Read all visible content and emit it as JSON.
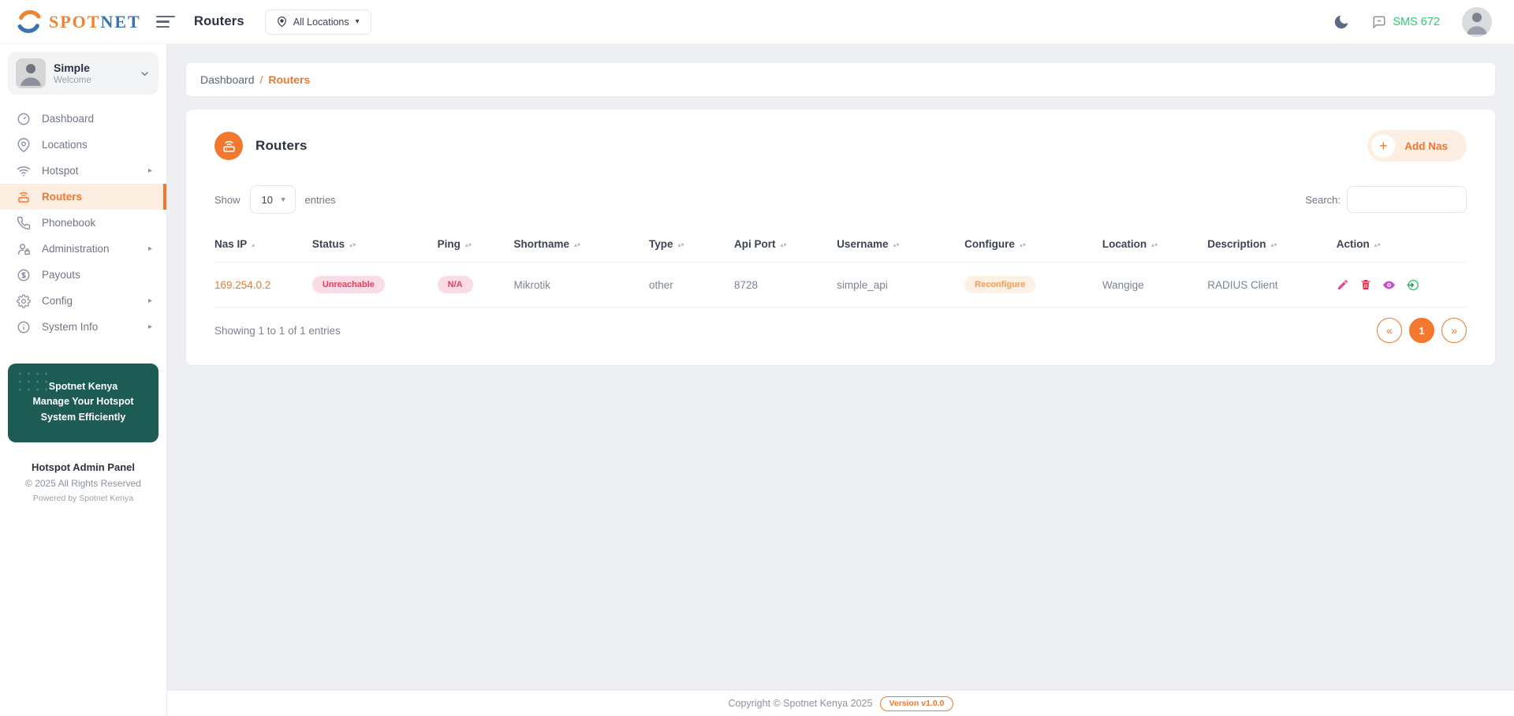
{
  "colors": {
    "accent": "#f4772e",
    "accent_soft": "#fdeee2",
    "danger_text": "#f23a5e",
    "danger_bg": "#fbdce4",
    "reconfigure_text": "#f59d54",
    "reconfigure_bg": "#fdf0e4",
    "sms_green": "#2ecc71",
    "promo_teal": "#1d5c55",
    "logo_orange": "#ee8432",
    "logo_blue": "#3a72b5"
  },
  "topbar": {
    "logo_part1": "SPOT",
    "logo_part2": "NET",
    "page_title": "Routers",
    "location_button": "All Locations",
    "location_caret": "▾",
    "sms_badge": "SMS 672",
    "icons": {
      "menu": "hamburger-icon",
      "dark_mode": "moon-icon",
      "messages": "chat-icon",
      "profile": "avatar"
    }
  },
  "sidebar": {
    "user": {
      "name": "Simple",
      "subtitle": "Welcome"
    },
    "items": [
      {
        "label": "Dashboard",
        "icon": "gauge-icon",
        "expandable": false,
        "active": false
      },
      {
        "label": "Locations",
        "icon": "map-pin-icon",
        "expandable": false,
        "active": false
      },
      {
        "label": "Hotspot",
        "icon": "wifi-icon",
        "expandable": true,
        "active": false
      },
      {
        "label": "Routers",
        "icon": "router-icon",
        "expandable": false,
        "active": true
      },
      {
        "label": "Phonebook",
        "icon": "phone-icon",
        "expandable": false,
        "active": false
      },
      {
        "label": "Administration",
        "icon": "user-lock-icon",
        "expandable": true,
        "active": false
      },
      {
        "label": "Payouts",
        "icon": "dollar-icon",
        "expandable": false,
        "active": false
      },
      {
        "label": "Config",
        "icon": "gear-icon",
        "expandable": true,
        "active": false
      },
      {
        "label": "System Info",
        "icon": "info-icon",
        "expandable": true,
        "active": false
      }
    ],
    "expand_glyph": "▸",
    "promo": {
      "line1": "Spotnet Kenya",
      "line2": "Manage Your Hotspot",
      "line3": "System Efficiently"
    },
    "panel_name": "Hotspot Admin Panel",
    "rights": "© 2025 All Rights Reserved",
    "powered": "Powered by Spotnet Kenya"
  },
  "breadcrumb": {
    "parent": "Dashboard",
    "separator": "/",
    "current": "Routers"
  },
  "routers_card": {
    "title": "Routers",
    "add_nas_button": "Add Nas",
    "plus_glyph": "+",
    "show_label": "Show",
    "page_size": "10",
    "entries_label": "entries",
    "search_label": "Search:",
    "search_value": "",
    "table": {
      "headers": [
        "Nas IP",
        "Status",
        "Ping",
        "Shortname",
        "Type",
        "Api Port",
        "Username",
        "Configure",
        "Location",
        "Description",
        "Action"
      ],
      "sorted_by": "Nas IP",
      "sort_direction": "asc",
      "rows": [
        {
          "nas_ip": "169.254.0.2",
          "status": "Unreachable",
          "ping": "N/A",
          "shortname": "Mikrotik",
          "type": "other",
          "api_port": "8728",
          "username": "simple_api",
          "configure": "Reconfigure",
          "location": "Wangige",
          "description": "RADIUS Client",
          "actions": [
            "edit-icon",
            "delete-icon",
            "view-icon",
            "login-icon"
          ]
        }
      ]
    },
    "footer": {
      "showing": "Showing 1 to 1 of 1 entries",
      "prev": "«",
      "page": "1",
      "next": "»"
    }
  },
  "page_footer": {
    "copyright": "Copyright © Spotnet Kenya 2025",
    "version_badge": "Version v1.0.0"
  }
}
